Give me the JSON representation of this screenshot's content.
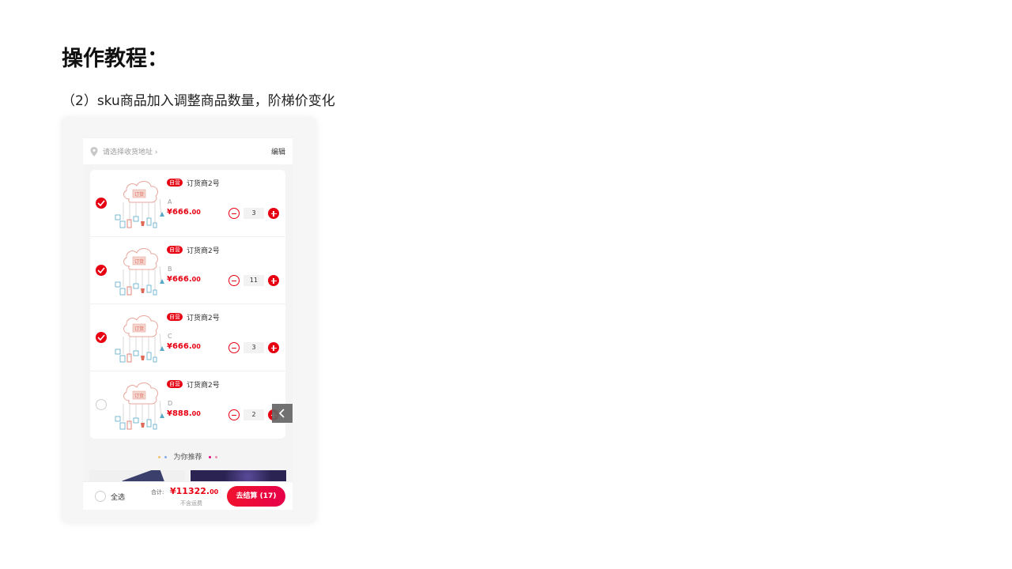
{
  "page": {
    "title": "操作教程：",
    "subtitle": "（2）sku商品加入调整商品数量，阶梯价变化"
  },
  "address": {
    "placeholder": "请选择收货地址 ›",
    "edit_label": "编辑"
  },
  "items": [
    {
      "tag": "自营",
      "store": "订货商2号",
      "sku": "A",
      "price_main": "¥666.",
      "price_dec": "00",
      "qty": "3",
      "checked": true
    },
    {
      "tag": "自营",
      "store": "订货商2号",
      "sku": "B",
      "price_main": "¥666.",
      "price_dec": "00",
      "qty": "11",
      "checked": true
    },
    {
      "tag": "自营",
      "store": "订货商2号",
      "sku": "C",
      "price_main": "¥666.",
      "price_dec": "00",
      "qty": "3",
      "checked": true
    },
    {
      "tag": "自营",
      "store": "订货商2号",
      "sku": "D",
      "price_main": "¥888.",
      "price_dec": "00",
      "qty": "2",
      "checked": false
    }
  ],
  "thumb_text": "订货",
  "recommend": {
    "label": "为你推荐"
  },
  "footer": {
    "select_all": "全选",
    "total_label": "合计:",
    "total_main": "¥11322.",
    "total_dec": "00",
    "shipping_note": "不含运费",
    "checkout_label": "去结算 (17)"
  },
  "colors": {
    "accent": "#e60012",
    "thumb_line": "#e8a59c",
    "thumb_blue": "#5aa8c8"
  },
  "icons": {
    "address": "location-pin-icon",
    "float": "chevron-left-icon"
  }
}
